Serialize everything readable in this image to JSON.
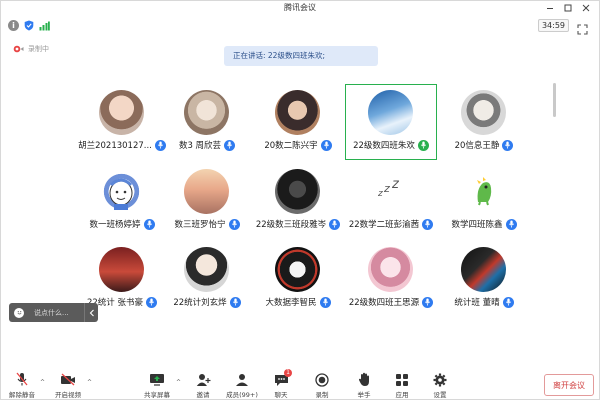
{
  "window": {
    "title": "腾讯会议"
  },
  "infobar": {
    "timer": "34:59"
  },
  "recording": {
    "label": "录制中"
  },
  "speaker_banner": {
    "text": "正在讲话: 22级数四班朱欢;"
  },
  "participants": [
    {
      "name": "胡兰202130127...",
      "mic": "blue",
      "avatar_icon": "anime-girl-avatar"
    },
    {
      "name": "数3 周欣芸",
      "mic": "blue",
      "avatar_icon": "anime-character-avatar"
    },
    {
      "name": "20数二陈兴宇",
      "mic": "blue",
      "avatar_icon": "anime-portrait-avatar"
    },
    {
      "name": "22级数四班朱欢",
      "mic": "green",
      "avatar_icon": "landscape-avatar",
      "active": true
    },
    {
      "name": "20信息王静",
      "mic": "blue",
      "avatar_icon": "cartoon-avatar"
    },
    {
      "name": "数一班杨婷婷",
      "mic": "blue",
      "avatar_icon": "doodle-avatar"
    },
    {
      "name": "数三班罗怡宁",
      "mic": "blue",
      "avatar_icon": "sunset-avatar"
    },
    {
      "name": "22级数三班段雅岑",
      "mic": "blue",
      "avatar_icon": "dark-portrait-avatar"
    },
    {
      "name": "22数学二班彭渝茜",
      "mic": "blue",
      "avatar_icon": "sleeping-zzz-avatar"
    },
    {
      "name": "数学四班陈鑫",
      "mic": "blue",
      "avatar_icon": "green-dino-avatar"
    },
    {
      "name": "22统计 张书豪",
      "mic": "blue",
      "avatar_icon": "red-sky-avatar"
    },
    {
      "name": "22统计刘玄烨",
      "mic": "blue",
      "avatar_icon": "anime-boy-avatar"
    },
    {
      "name": "大数据李智民",
      "mic": "blue",
      "avatar_icon": "mask-avatar"
    },
    {
      "name": "22级数四班王思源",
      "mic": "blue",
      "avatar_icon": "pink-anime-avatar"
    },
    {
      "name": "统计班 董晴",
      "mic": "blue",
      "avatar_icon": "glitch-girl-avatar"
    }
  ],
  "chat": {
    "placeholder": "说点什么..."
  },
  "toolbar": {
    "unmute": "解除静音",
    "video": "开启视频",
    "share": "共享屏幕",
    "invite": "邀请",
    "members": "成员(99+)",
    "chat": "聊天",
    "chat_badge": "1",
    "record": "录制",
    "raise_hand": "举手",
    "apps": "应用",
    "settings": "设置",
    "leave": "离开会议"
  },
  "colors": {
    "accent_blue": "#2f7bf0",
    "speaking_green": "#28b04e",
    "leave_red": "#d04040",
    "mute_red": "#e84545"
  }
}
